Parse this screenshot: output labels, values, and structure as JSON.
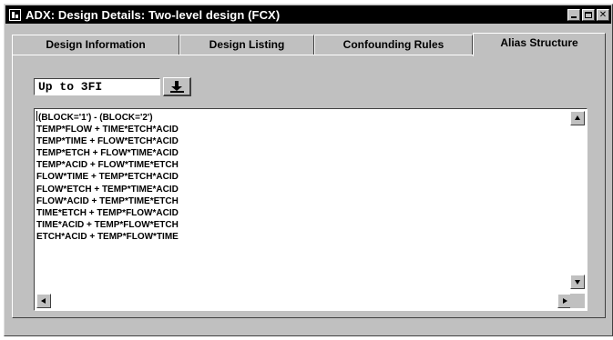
{
  "window": {
    "title": "ADX: Design Details: Two-level design (FCX)",
    "icon": "app-icon",
    "controls": [
      "minimize-icon",
      "maximize-icon",
      "close-icon"
    ]
  },
  "tabs": [
    {
      "label": "Design Information",
      "active": false
    },
    {
      "label": "Design Listing",
      "active": false
    },
    {
      "label": "Confounding Rules",
      "active": false
    },
    {
      "label": "Alias Structure",
      "active": true
    }
  ],
  "filter": {
    "selected": "Up to 3FI",
    "button_icon": "drop-down-arrow-icon"
  },
  "alias_lines": [
    "(BLOCK='1') - (BLOCK='2')",
    "TEMP*FLOW + TIME*ETCH*ACID",
    "TEMP*TIME + FLOW*ETCH*ACID",
    "TEMP*ETCH + FLOW*TIME*ACID",
    "TEMP*ACID + FLOW*TIME*ETCH",
    "FLOW*TIME + TEMP*ETCH*ACID",
    "FLOW*ETCH + TEMP*TIME*ACID",
    "FLOW*ACID + TEMP*TIME*ETCH",
    "TIME*ETCH + TEMP*FLOW*ACID",
    "TIME*ACID + TEMP*FLOW*ETCH",
    "ETCH*ACID + TEMP*FLOW*TIME"
  ],
  "colors": {
    "title_bar": "#000000",
    "face": "#c0c0c0",
    "text_area": "#ffffff"
  }
}
